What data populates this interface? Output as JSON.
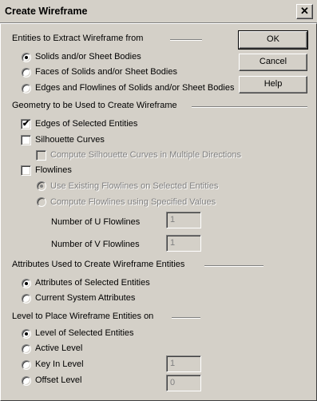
{
  "window": {
    "title": "Create Wireframe",
    "close_glyph": "✕"
  },
  "buttons": {
    "ok": "OK",
    "cancel": "Cancel",
    "help": "Help"
  },
  "entities": {
    "label": "Entities to Extract Wireframe from",
    "options": [
      "Solids and/or Sheet Bodies",
      "Faces of Solids and/or Sheet Bodies",
      "Edges and Flowlines of Solids and/or Sheet Bodies"
    ],
    "selected": 0
  },
  "geometry": {
    "label": "Geometry to be Used to Create Wireframe",
    "edges_label": "Edges of Selected Entities",
    "edges_checked": true,
    "silhouette_label": "Silhouette Curves",
    "silhouette_checked": false,
    "multi_dir_label": "Compute Silhouette Curves in Multiple Directions",
    "flowlines_label": "Flowlines",
    "flowlines_checked": false,
    "use_existing_label": "Use Existing Flowlines on Selected Entities",
    "compute_label": "Compute Flowlines using Specified Values",
    "u_label": "Number of U Flowlines",
    "u_value": "1",
    "v_label": "Number of V Flowlines",
    "v_value": "1"
  },
  "attributes": {
    "label": "Attributes Used to Create Wireframe Entities",
    "options": [
      "Attributes of Selected Entities",
      "Current System Attributes"
    ],
    "selected": 0
  },
  "level": {
    "label": "Level to Place Wireframe Entities on",
    "options": [
      "Level of Selected Entities",
      "Active Level",
      "Key In Level",
      "Offset Level"
    ],
    "selected": 0,
    "key_in_value": "1",
    "offset_value": "0"
  }
}
